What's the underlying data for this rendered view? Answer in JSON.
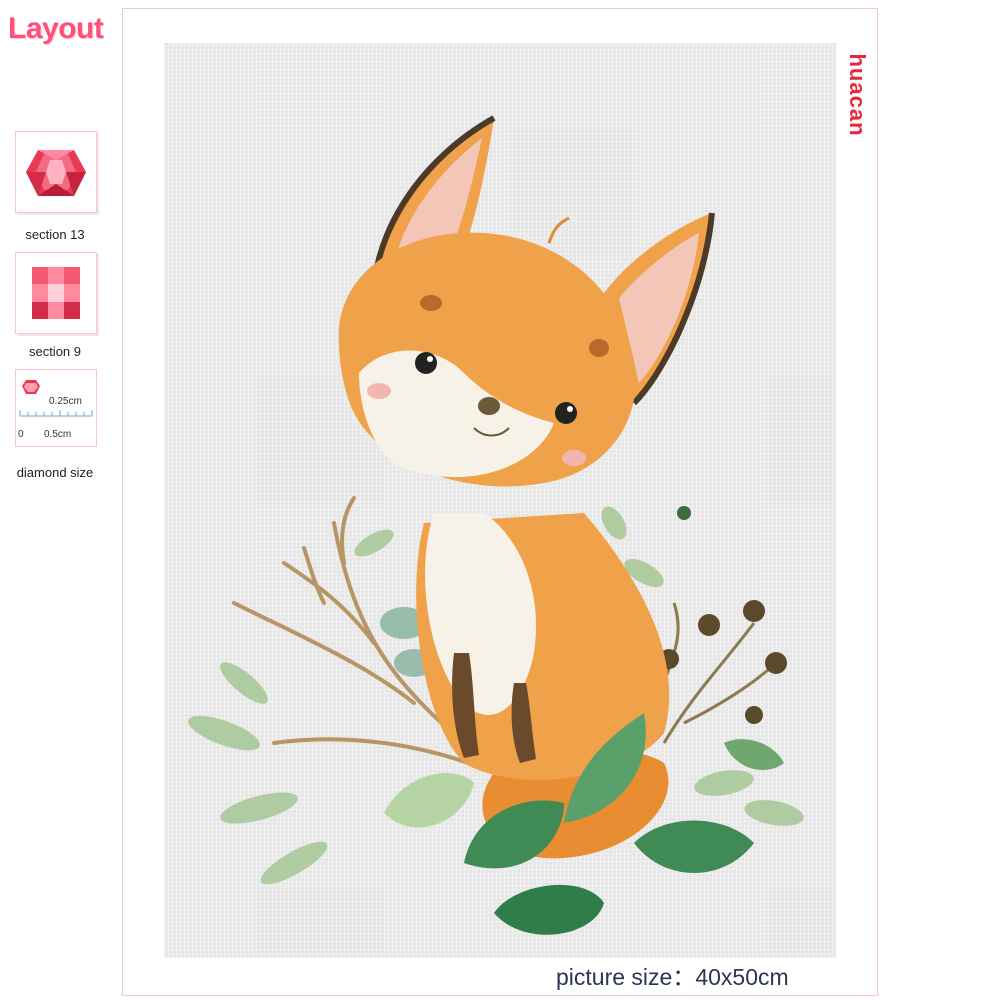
{
  "sidebar": {
    "title": "Layout",
    "swatches": [
      {
        "label": "section 13",
        "icon": "round-diamond-drill-icon"
      },
      {
        "label": "section 9",
        "icon": "square-diamond-drill-icon"
      }
    ],
    "diamond_size": {
      "label": "diamond size",
      "drill_size": "0.25cm",
      "ruler_start": "0",
      "ruler_end": "0.5cm",
      "icon": "diamond-size-ruler-icon"
    }
  },
  "artwork": {
    "subject": "fox-illustration",
    "brand": "huacan",
    "picture_size": "picture size：40x50cm",
    "colors": {
      "accent": "#ff4f7a",
      "brand": "#e8273a",
      "fox_orange": "#f0a24a",
      "leaf_green": "#2f7d4a",
      "canvas": "#e6e6e6"
    }
  }
}
